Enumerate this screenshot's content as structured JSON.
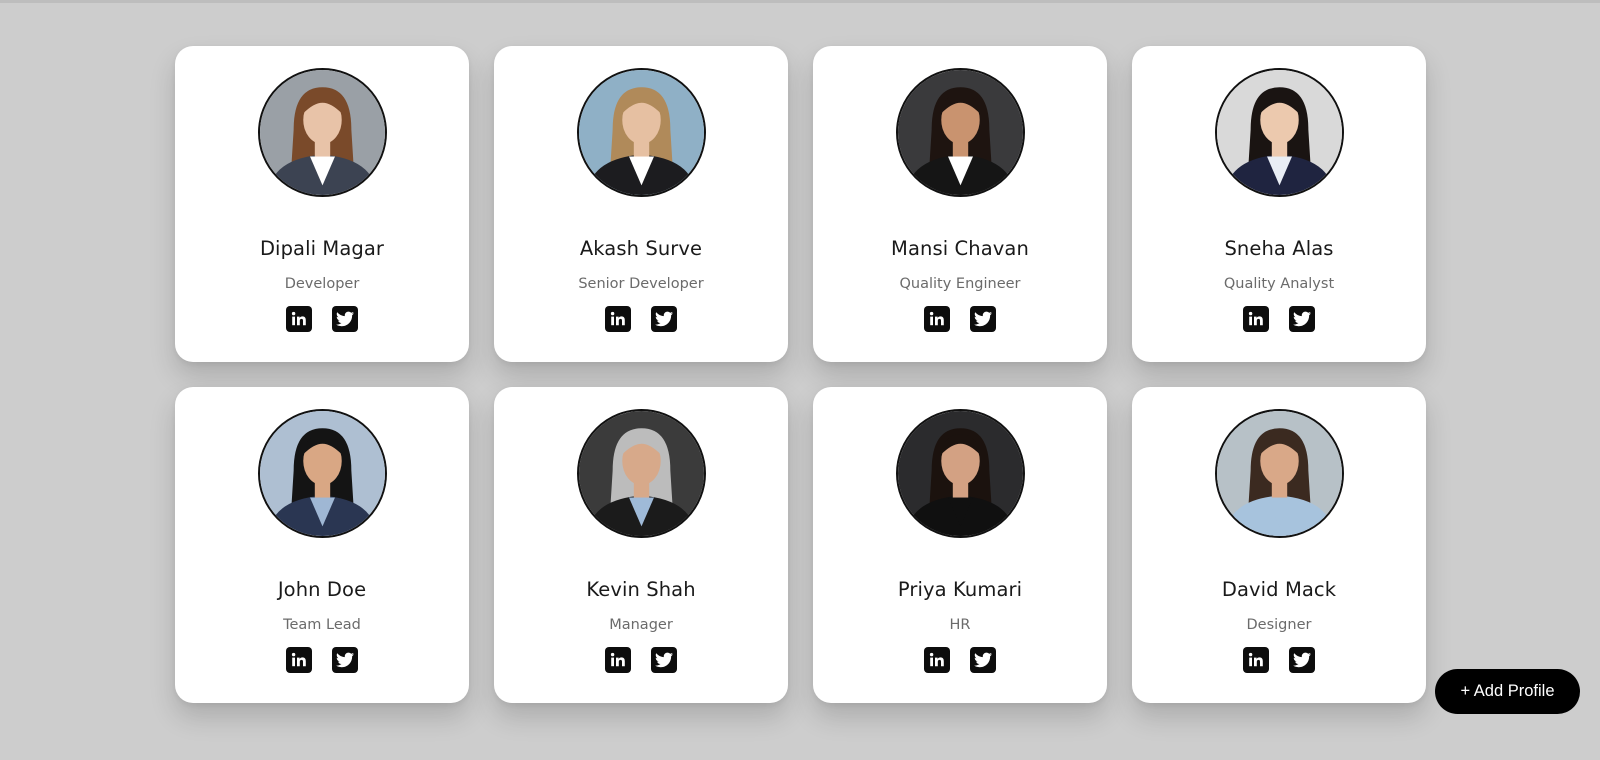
{
  "profiles": [
    {
      "name": "Dipali Magar",
      "role": "Developer",
      "bg": "#9aa0a6",
      "skin": "#e8c3a8",
      "hair": "#7a4a2a",
      "suit": "#3c4352",
      "shirt": "#ffffff"
    },
    {
      "name": "Akash Surve",
      "role": "Senior Developer",
      "bg": "#8fb0c6",
      "skin": "#e6c0a2",
      "hair": "#b08a5a",
      "suit": "#1c1c1f",
      "shirt": "#ffffff"
    },
    {
      "name": "Mansi Chavan",
      "role": "Quality Engineer",
      "bg": "#3a3a3c",
      "skin": "#c9936f",
      "hair": "#1e1410",
      "suit": "#151515",
      "shirt": "#ffffff"
    },
    {
      "name": "Sneha Alas",
      "role": "Quality Analyst",
      "bg": "#d9d9d9",
      "skin": "#ecc9ae",
      "hair": "#1a1412",
      "suit": "#1f2440",
      "shirt": "#e9eef5"
    },
    {
      "name": "John Doe",
      "role": "Team Lead",
      "bg": "#aebfd2",
      "skin": "#d9a784",
      "hair": "#141414",
      "suit": "#2a3652",
      "shirt": "#9fb7d4"
    },
    {
      "name": "Kevin Shah",
      "role": "Manager",
      "bg": "#3b3b3b",
      "skin": "#d7a98a",
      "hair": "#bcbcbc",
      "suit": "#1b1b1b",
      "shirt": "#9fbad8"
    },
    {
      "name": "Priya Kumari",
      "role": "HR",
      "bg": "#2b2b2d",
      "skin": "#d3a183",
      "hair": "#1b120e",
      "suit": "#101010",
      "shirt": "#101010"
    },
    {
      "name": "David Mack",
      "role": "Designer",
      "bg": "#b7c1c7",
      "skin": "#d9a888",
      "hair": "#3b2a20",
      "suit": "#a7c3dd",
      "shirt": "#a7c3dd"
    }
  ],
  "social_icons": [
    "linkedin-icon",
    "twitter-icon"
  ],
  "actions": {
    "add_profile_label": "+ Add Profile"
  },
  "colors": {
    "background": "#cdcdcd",
    "card": "#ffffff",
    "button": "#000000",
    "text_primary": "#1a1a1a",
    "text_secondary": "#6b6b6b"
  }
}
